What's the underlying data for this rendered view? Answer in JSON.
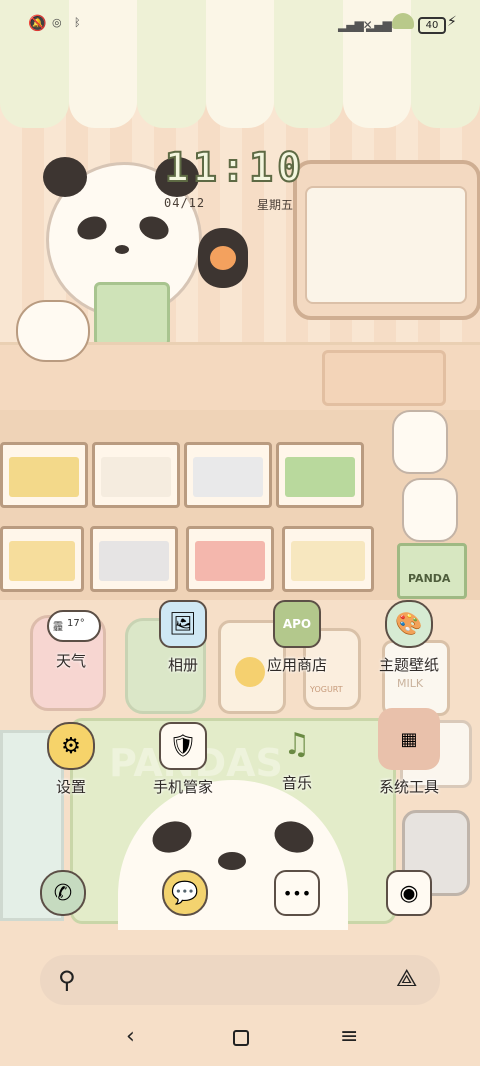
{
  "status_bar": {
    "icons": [
      "bell-off-icon",
      "nfc-icon",
      "bluetooth-icon",
      "signal-x-icon",
      "signal-x-icon",
      "wifi-icon"
    ],
    "battery": "40",
    "charging": "⚡"
  },
  "clock": {
    "time": "11:10",
    "date": "04/12",
    "weekday": "星期五"
  },
  "weather_widget": {
    "condition": "霾",
    "temperature": "17°"
  },
  "apps": [
    {
      "label": "天气",
      "icon": "weather-icon"
    },
    {
      "label": "相册",
      "icon": "gallery-icon"
    },
    {
      "label": "应用商店",
      "icon": "app-store-icon"
    },
    {
      "label": "主题壁纸",
      "icon": "themes-icon"
    },
    {
      "label": "设置",
      "icon": "settings-gear-icon"
    },
    {
      "label": "手机管家",
      "icon": "security-shield-icon"
    },
    {
      "label": "音乐",
      "icon": "music-note-icon"
    },
    {
      "label": "系统工具",
      "icon": "system-tools-folder-icon"
    }
  ],
  "dock": [
    {
      "icon": "phone-icon"
    },
    {
      "icon": "messages-icon"
    },
    {
      "icon": "browser-icon"
    },
    {
      "icon": "camera-icon"
    }
  ],
  "decor": {
    "apo_sign": "APO",
    "milk_label": "MILK",
    "yogurt_label": "YOGURT",
    "book_label": "PANDA",
    "mat_text": "PANDAS"
  },
  "colors": {
    "accent_green": "#b9c98a",
    "text_dark": "#2f2a27",
    "background": "#f7e4cf"
  }
}
